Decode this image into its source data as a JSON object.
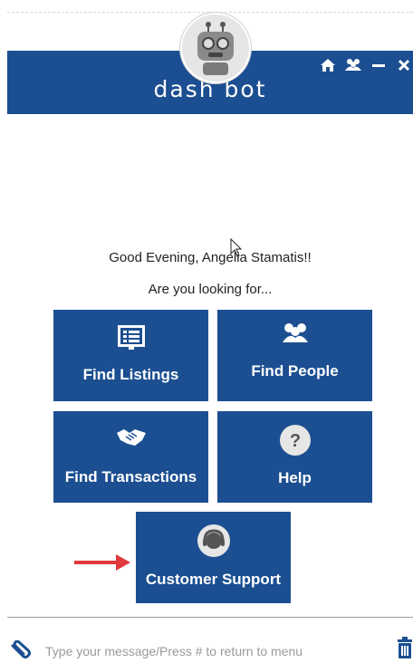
{
  "header": {
    "title": "dash bot",
    "icons": [
      "home-icon",
      "people-icon",
      "minimize-icon",
      "close-icon"
    ]
  },
  "greeting": "Good Evening, Angelia Stamatis!!",
  "prompt": "Are you looking for...",
  "menu": {
    "find_listings": {
      "label": "Find Listings",
      "icon": "listing-icon"
    },
    "find_people": {
      "label": "Find People",
      "icon": "people-icon"
    },
    "find_transactions": {
      "label": "Find Transactions",
      "icon": "handshake-icon"
    },
    "help": {
      "label": "Help",
      "icon": "question-icon"
    },
    "customer_support": {
      "label": "Customer Support",
      "icon": "headset-icon"
    }
  },
  "composer": {
    "placeholder": "Type your message/Press # to return to menu"
  },
  "colors": {
    "brand": "#1c4f91",
    "arrow": "#e0393e"
  }
}
